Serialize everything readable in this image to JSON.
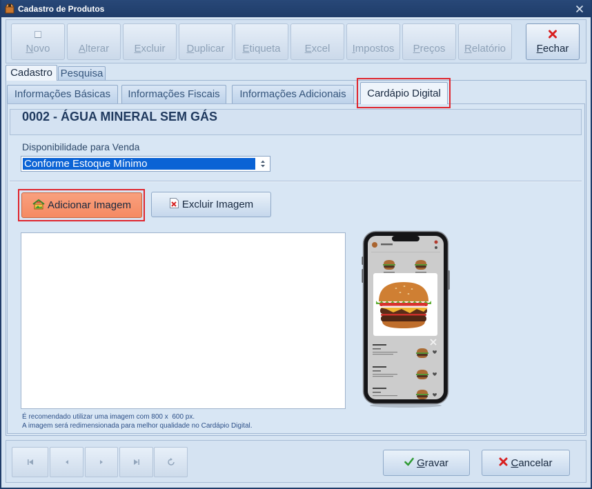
{
  "window": {
    "title": "Cadastro de Produtos",
    "icon": "product-box-icon",
    "close_icon": "close-icon"
  },
  "toolbar": {
    "buttons": [
      {
        "label": "Novo",
        "enabled": false,
        "icon": "new-record-icon"
      },
      {
        "label": "Alterar",
        "enabled": false
      },
      {
        "label": "Excluir",
        "enabled": false
      },
      {
        "label": "Duplicar",
        "enabled": false
      },
      {
        "label": "Etiqueta",
        "enabled": false
      },
      {
        "label": "Excel",
        "enabled": false
      },
      {
        "label": "Impostos",
        "enabled": false
      },
      {
        "label": "Preços",
        "enabled": false
      },
      {
        "label": "Relatório",
        "enabled": false
      }
    ],
    "close": {
      "label": "Fechar",
      "enabled": true,
      "icon": "red-x-icon"
    }
  },
  "main_tabs": [
    {
      "label": "Cadastro",
      "active": true
    },
    {
      "label": "Pesquisa",
      "active": false
    }
  ],
  "sub_tabs": [
    {
      "label": "Informações Básicas",
      "active": false
    },
    {
      "label": "Informações Fiscais",
      "active": false
    },
    {
      "label": "Informações Adicionais",
      "active": false
    },
    {
      "label": "Cardápio Digital",
      "active": true,
      "highlighted": true
    }
  ],
  "product": {
    "header": "0002 - ÁGUA MINERAL SEM GÁS"
  },
  "availability": {
    "label": "Disponibilidade para Venda",
    "selected": "Conforme Estoque Mínimo"
  },
  "image": {
    "add_label": "Adicionar Imagem",
    "add_icon": "add-image-icon",
    "add_highlighted": true,
    "remove_label": "Excluir Imagem",
    "remove_icon": "delete-image-icon",
    "hints": [
      "É recomendado utilizar uma imagem com 800 x  600 px.",
      "A imagem será redimensionada para melhor qualidade no Cardápio Digital."
    ]
  },
  "navigation": {
    "buttons": [
      {
        "icon": "first-record-icon",
        "enabled": false
      },
      {
        "icon": "previous-record-icon",
        "enabled": false
      },
      {
        "icon": "next-record-icon",
        "enabled": false
      },
      {
        "icon": "last-record-icon",
        "enabled": false
      },
      {
        "icon": "refresh-icon",
        "enabled": false
      }
    ]
  },
  "footer": {
    "save": {
      "label": "Gravar",
      "icon": "green-check-icon"
    },
    "cancel": {
      "label": "Cancelar",
      "icon": "red-x-icon"
    }
  },
  "colors": {
    "title_bar": "#1f3c69",
    "window_bg": "#d7e5f3",
    "highlight_box": "#e0242c",
    "add_image_button": "#f58a62",
    "selection": "#0b63d5",
    "disabled_text": "#8ea2b8"
  }
}
